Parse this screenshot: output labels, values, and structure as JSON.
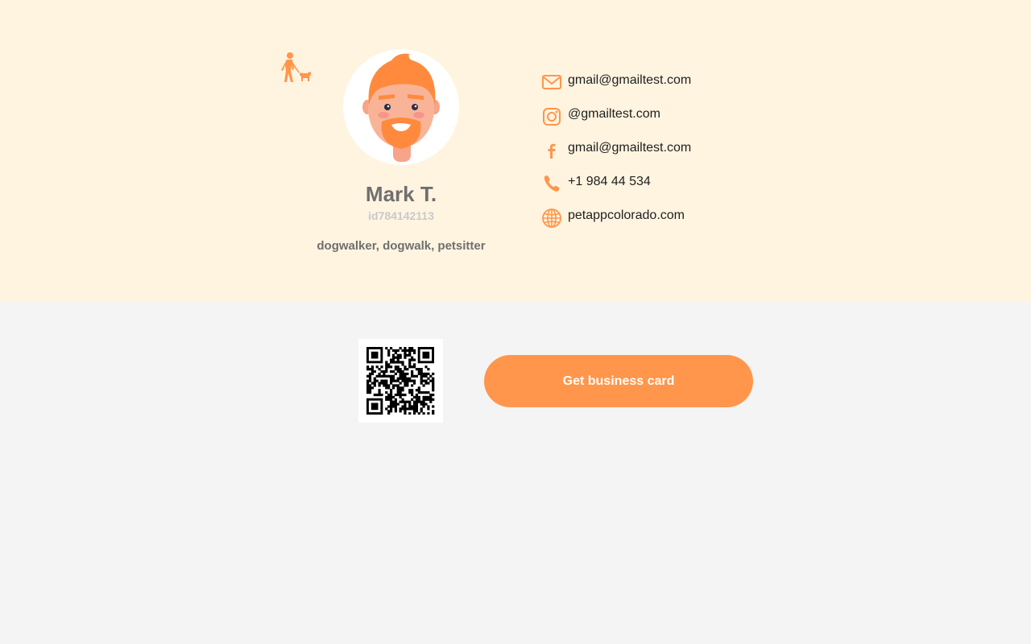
{
  "profile": {
    "name": "Mark T.",
    "id": "id784142113",
    "tags": "dogwalker, dogwalk, petsitter",
    "category_icon": "dog-walker-icon",
    "avatar_icon": "bearded-man-avatar"
  },
  "contacts": [
    {
      "type": "email",
      "icon": "envelope-icon",
      "value": "gmail@gmailtest.com"
    },
    {
      "type": "instagram",
      "icon": "instagram-icon",
      "value": "@gmailtest.com"
    },
    {
      "type": "facebook",
      "icon": "facebook-icon",
      "value": "gmail@gmailtest.com"
    },
    {
      "type": "phone",
      "icon": "phone-icon",
      "value": "+1 984 44 534"
    },
    {
      "type": "website",
      "icon": "globe-icon",
      "value": "petappcolorado.com"
    }
  ],
  "actions": {
    "get_card_label": "Get business card"
  },
  "qr": {
    "icon": "qr-code"
  },
  "colors": {
    "accent": "#ff964b",
    "top_background": "#fff4e0",
    "page_background": "#f4f4f4",
    "name_text": "#6f6f6f",
    "id_text": "#c9c9c9"
  }
}
